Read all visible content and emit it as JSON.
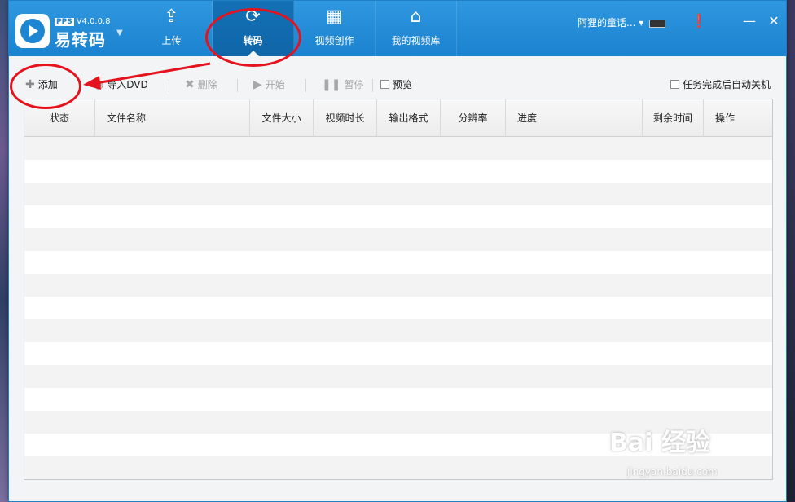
{
  "brand": {
    "pps": "PPS",
    "version": "V4.0.0.8",
    "name": "易转码"
  },
  "nav": [
    {
      "label": "上传",
      "icon": "upload-icon"
    },
    {
      "label": "转码",
      "icon": "convert-icon",
      "active": true
    },
    {
      "label": "视频创作",
      "icon": "film-icon"
    },
    {
      "label": "我的视频库",
      "icon": "library-icon"
    }
  ],
  "account": {
    "name": "阿狸的童话..."
  },
  "toolbar": {
    "add": "添加",
    "import_dvd": "导入DVD",
    "delete": "删除",
    "start": "开始",
    "pause": "暂停",
    "preview": "预览",
    "auto_shutdown": "任务完成后自动关机"
  },
  "table": {
    "columns": [
      "状态",
      "文件名称",
      "文件大小",
      "视频时长",
      "输出格式",
      "分辨率",
      "进度",
      "剩余时间",
      "操作"
    ],
    "rows": []
  },
  "watermark": {
    "main": "Bai 经验",
    "sub": "jingyan.baidu.com"
  },
  "colors": {
    "titlebar": "#1b82cf",
    "active_tab": "#1470b5",
    "annotation": "#e5131e"
  }
}
